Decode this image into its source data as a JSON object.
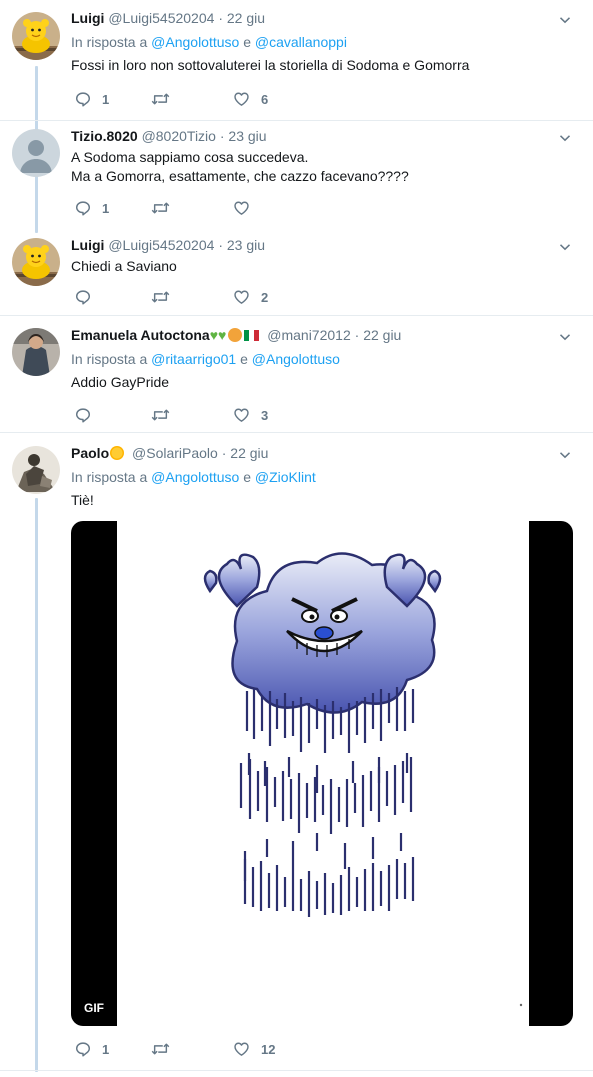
{
  "tweets": [
    {
      "name": "Luigi",
      "handle": "@Luigi54520204",
      "date": "22 giu",
      "reply_prefix": "In risposta a",
      "reply_mentions": [
        "@Angolottuso",
        "@cavallanoppi"
      ],
      "reply_conj": "e",
      "text": "Fossi in loro non sottovaluterei la storiella di Sodoma e Gomorra",
      "replies": "1",
      "retweets": "",
      "likes": "6"
    },
    {
      "name": "Tizio.8020",
      "handle": "@8020Tizio",
      "date": "23 giu",
      "text": "A Sodoma sappiamo cosa succedeva.\nMa a Gomorra, esattamente, che cazzo facevano????",
      "replies": "1",
      "retweets": "",
      "likes": ""
    },
    {
      "name": "Luigi",
      "handle": "@Luigi54520204",
      "date": "23 giu",
      "text": "Chiedi a Saviano",
      "replies": "",
      "retweets": "",
      "likes": "2"
    },
    {
      "name": "Emanuela Autoctona",
      "handle": "@mani72012",
      "date": "22 giu",
      "reply_prefix": "In risposta a",
      "reply_mentions": [
        "@ritaarrigo01",
        "@Angolottuso"
      ],
      "reply_conj": "e",
      "text": "Addio GayPride",
      "replies": "",
      "retweets": "",
      "likes": "3"
    },
    {
      "name": "Paolo",
      "handle": "@SolariPaolo",
      "date": "22 giu",
      "reply_prefix": "In risposta a",
      "reply_mentions": [
        "@Angolottuso",
        "@ZioKlint"
      ],
      "reply_conj": "e",
      "text": "Tiè!",
      "media_badge": "GIF",
      "replies": "1",
      "retweets": "",
      "likes": "12"
    }
  ],
  "colors": {
    "link": "#1da1f2",
    "muted": "#657786",
    "thread_line": "#c4d8ea",
    "separator": "#e6ecf0"
  },
  "icons": [
    "reply-icon",
    "retweet-icon",
    "like-icon",
    "caret-down-icon",
    "green-heart-emoji",
    "lion-emoji",
    "italy-flag-emoji",
    "sun-emoji"
  ]
}
